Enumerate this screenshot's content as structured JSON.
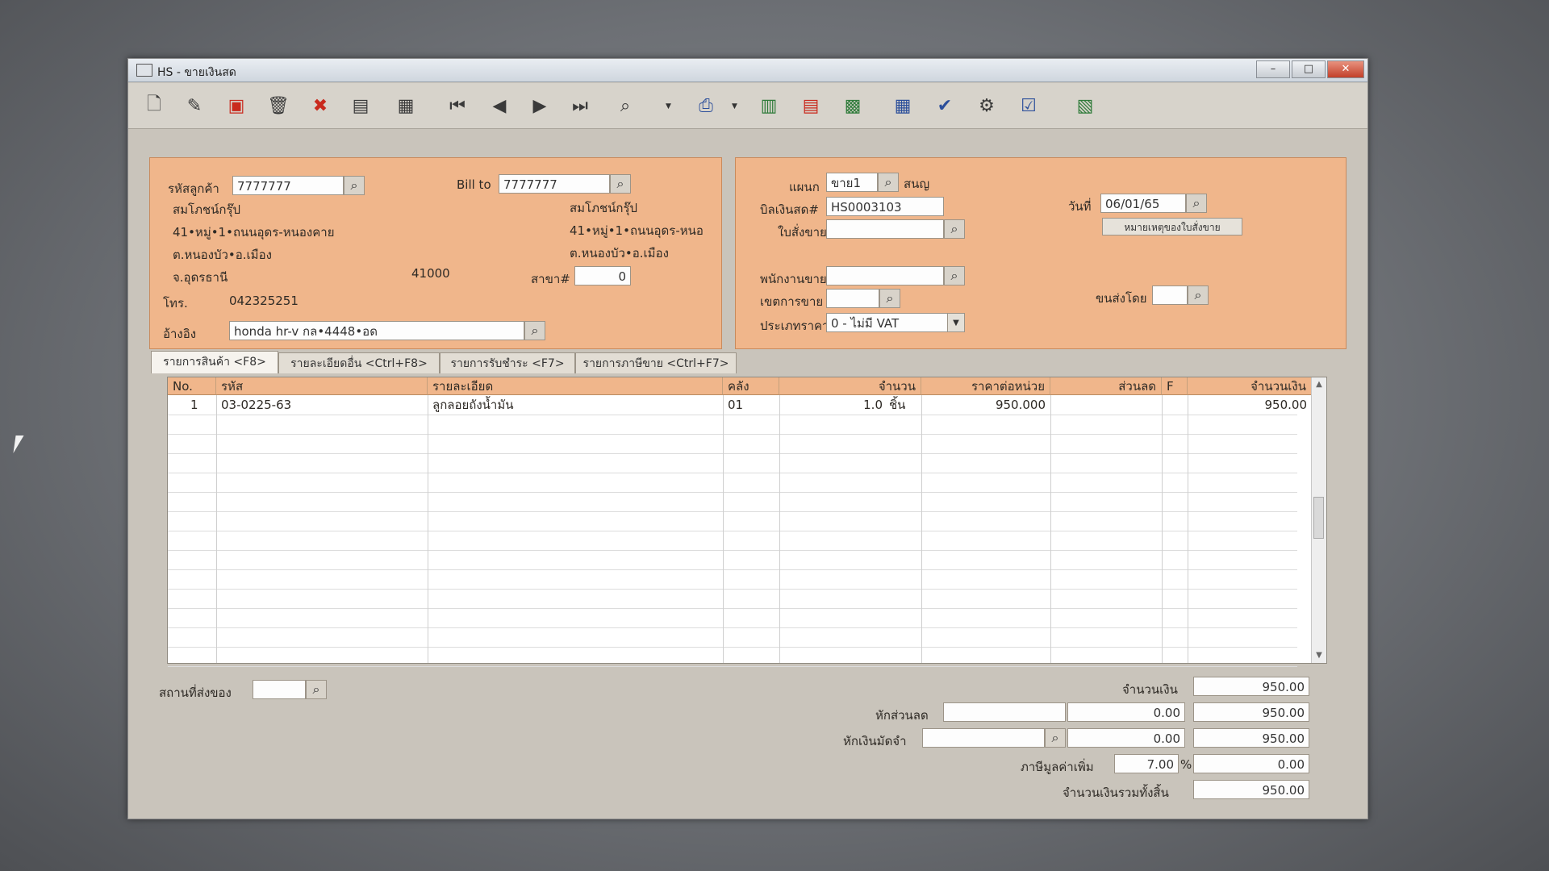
{
  "window": {
    "title": "HS - ขายเงินสด"
  },
  "header": {
    "customer_code_label": "รหัสลูกค้า",
    "customer_code": "7777777",
    "customer_name": "สมโภชน์กรุ๊ป",
    "address_line1": "41•หมู่•1•ถนนอุดร-หนองคาย",
    "address_line2": "ต.หนองบัว•อ.เมือง",
    "address_line3": "จ.อุดรธานี",
    "postcode": "41000",
    "phone_label": "โทร.",
    "phone": "042325251",
    "ref_label": "อ้างอิง",
    "ref_value": "honda hr-v กล•4448•อด",
    "bill_to_label": "Bill to",
    "bill_to_code": "7777777",
    "bill_to_name": "สมโภชน์กรุ๊ป",
    "bill_to_address1": "41•หมู่•1•ถนนอุดร-หนอ",
    "bill_to_address2": "ต.หนองบัว•อ.เมือง",
    "branch_label": "สาขา#",
    "branch_value": "0"
  },
  "doc": {
    "dept_label": "แผนก",
    "dept_value": "ขาย1",
    "dept_name": "สนญ",
    "bill_no_label": "บิลเงินสด#",
    "bill_no": "HS0003103",
    "order_label": "ใบสั่งขาย",
    "order_value": "",
    "date_label": "วันที่",
    "date_value": "06/01/65",
    "order_note_button": "หมายเหตุของใบสั่งขาย",
    "salesman_label": "พนักงานขาย",
    "salesman_value": "",
    "zone_label": "เขตการขาย",
    "zone_value": "",
    "shipby_label": "ขนส่งโดย",
    "shipby_value": "",
    "price_type_label": "ประเภทราคา",
    "price_type_value": "0 - ไม่มี VAT"
  },
  "tabs": [
    {
      "label": "รายการสินค้า <F8>"
    },
    {
      "label": "รายละเอียดอื่น <Ctrl+F8>"
    },
    {
      "label": "รายการรับชำระ <F7>"
    },
    {
      "label": "รายการภาษีขาย <Ctrl+F7>"
    }
  ],
  "table": {
    "columns": [
      "No.",
      "รหัส",
      "รายละเอียด",
      "คลัง",
      "จำนวน",
      "ราคาต่อหน่วย",
      "ส่วนลด",
      "F",
      "จำนวนเงิน"
    ],
    "rows": [
      {
        "no": "1",
        "code": "03-0225-63",
        "desc": "ลูกลอยถังน้ำมัน",
        "wh": "01",
        "qty": "1.0",
        "unit": "ชิ้น",
        "price": "950.000",
        "discount": "",
        "f": "",
        "amount": "950.00"
      }
    ]
  },
  "footer": {
    "ship_place_label": "สถานที่ส่งของ",
    "ship_place_value": "",
    "amount_label": "จำนวนเงิน",
    "amount": "950.00",
    "discount_label": "หักส่วนลด",
    "discount_text": "",
    "discount_value": "0.00",
    "after_discount": "950.00",
    "deposit_label": "หักเงินมัดจำ",
    "deposit_text": "",
    "deposit_value": "0.00",
    "after_deposit": "950.00",
    "vat_label": "ภาษีมูลค่าเพิ่ม",
    "vat_rate": "7.00",
    "percent_sign": "%",
    "vat_amount": "0.00",
    "grand_total_label": "จำนวนเงินรวมทั้งสิ้น",
    "grand_total": "950.00"
  }
}
